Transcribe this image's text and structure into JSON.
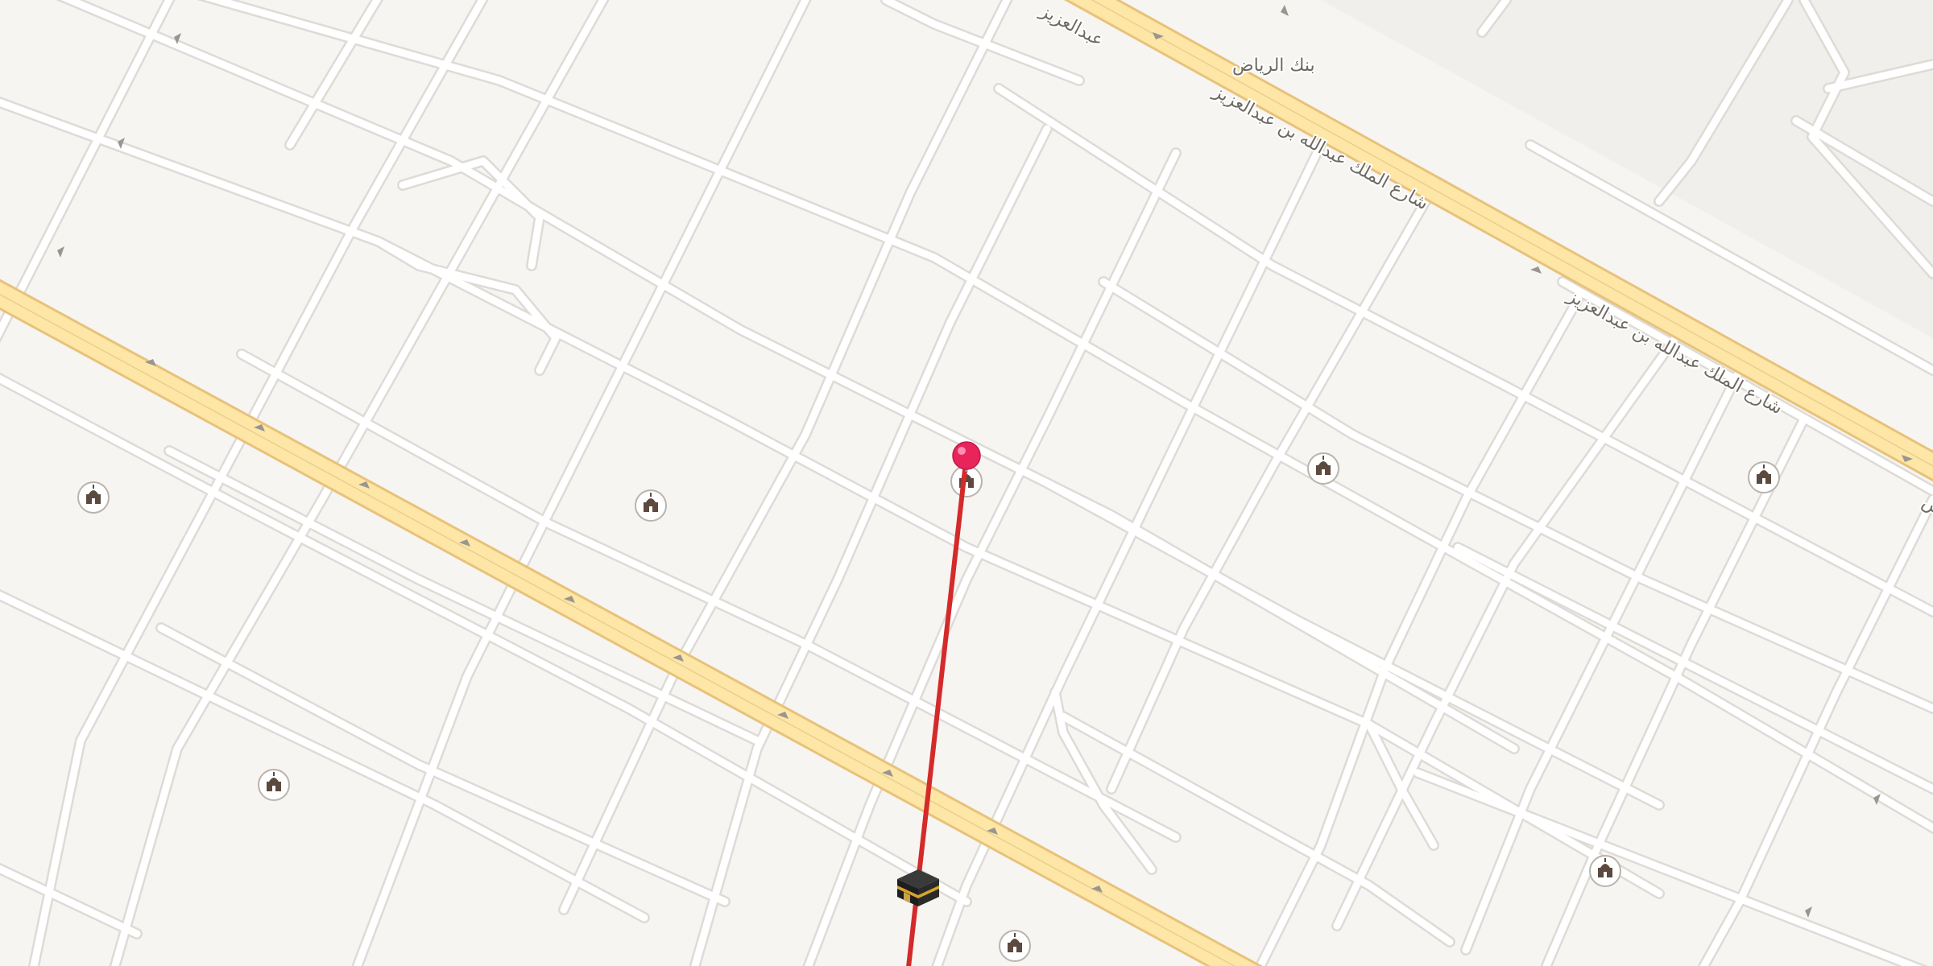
{
  "map": {
    "background_color": "#f7f5f2",
    "labels": {
      "bank": "بنك الرياض",
      "street_top_partial": "عبدالعزيز",
      "street_mid": "شارع الملك عبدالله بن عبدالعزيز",
      "street_right": "شارع الملك عبدالله بن عبدالعزيز",
      "street_edge_partial": "ش"
    },
    "route": {
      "color": "#d42a2a",
      "pin_color": "#f0285f",
      "destination_icon": "kaaba-icon"
    },
    "poi_icon": "mosque-icon",
    "mosque_count": 8
  }
}
